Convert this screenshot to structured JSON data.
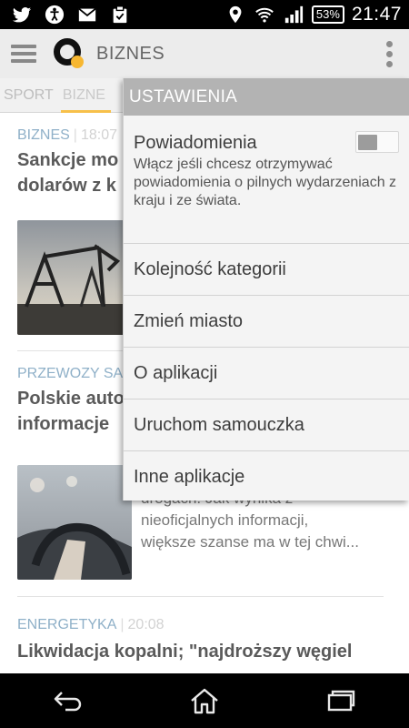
{
  "status_bar": {
    "icons": [
      "twitter-icon",
      "accessibility-icon",
      "gmail-icon",
      "clipboard-check-icon"
    ],
    "right_icons": [
      "location-icon",
      "wifi-icon",
      "signal-icon"
    ],
    "battery": "53%",
    "time": "21:47"
  },
  "action_bar": {
    "title": "BIZNES",
    "logo_colors": {
      "ring": "#111111",
      "dot": "#f7b731"
    }
  },
  "tabs": [
    {
      "label": "SPORT",
      "active": false
    },
    {
      "label": "BIZNE",
      "active": true
    }
  ],
  "articles": [
    {
      "category": "BIZNES",
      "time": "18:07",
      "headline_lines": [
        "Sankcje mo",
        "dolarów z k"
      ],
      "snippet_lines": []
    },
    {
      "category": "PRZEWOZY SA",
      "time": "",
      "headline_lines": [
        "Polskie auto",
        "informacje"
      ],
      "snippet_lines": [
        "drogach. Jak wynika z",
        "nieoficjalnych informacji,",
        "większe szanse ma w tej chwi..."
      ]
    },
    {
      "category": "ENERGETYKA",
      "time": "20:08",
      "headline_lines": [
        "Likwidacja kopalni; \"najdroższy węgiel"
      ],
      "snippet_lines": []
    }
  ],
  "settings_menu": {
    "header": "USTAWIENIA",
    "notifications": {
      "label": "Powiadomienia",
      "description": "Włącz jeśli chcesz otrzymywać powiadomienia o pilnych wydarzeniach z kraju i ze świata.",
      "enabled": false
    },
    "items": [
      {
        "label": "Kolejność kategorii"
      },
      {
        "label": "Zmień miasto"
      },
      {
        "label": "O aplikacji"
      },
      {
        "label": "Uruchom samouczka"
      },
      {
        "label": "Inne aplikacje"
      }
    ]
  },
  "nav_bar": {
    "buttons": [
      "back-icon",
      "home-icon",
      "recent-apps-icon"
    ]
  }
}
